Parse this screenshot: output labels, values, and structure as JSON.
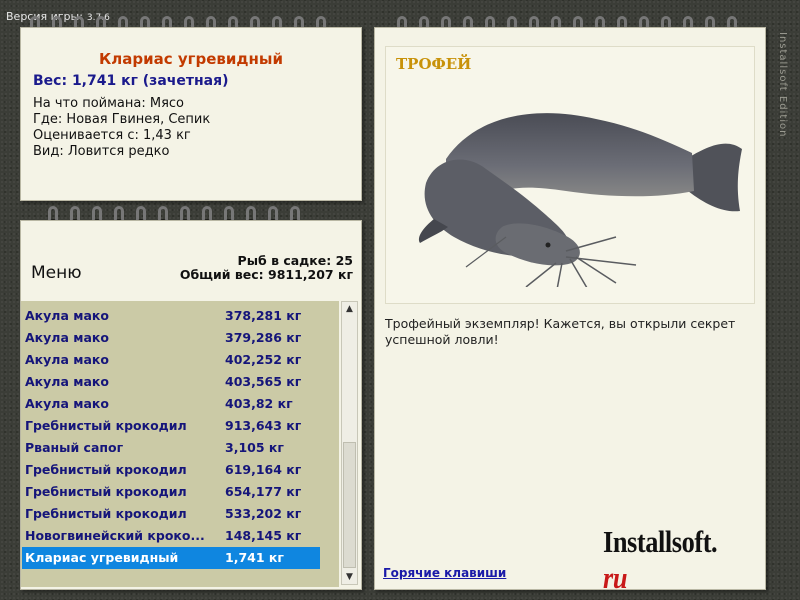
{
  "version": {
    "label": "Версия игры:",
    "number": "3.7.6"
  },
  "side_text": "Installsoft Edition",
  "info": {
    "title": "Клариас угревидный",
    "weight": "Вес: 1,741 кг (зачетная)",
    "bait": "На что поймана: Мясо",
    "location": "Где: Новая Гвинея, Сепик",
    "min_weight": "Оценивается с: 1,43 кг",
    "kind": "Вид: Ловится редко"
  },
  "catch": {
    "menu_label": "Меню",
    "fish_count": "Рыб в садке: 25",
    "total_weight": "Общий вес: 9811,207 кг",
    "rows": [
      {
        "name": "Акула мако",
        "weight": "378,281 кг"
      },
      {
        "name": "Акула мако",
        "weight": "379,286 кг"
      },
      {
        "name": "Акула мако",
        "weight": "402,252 кг"
      },
      {
        "name": "Акула мако",
        "weight": "403,565 кг"
      },
      {
        "name": "Акула мако",
        "weight": "403,82 кг"
      },
      {
        "name": "Гребнистый крокодил",
        "weight": "913,643 кг"
      },
      {
        "name": "Рваный сапог",
        "weight": "3,105 кг"
      },
      {
        "name": "Гребнистый крокодил",
        "weight": "619,164 кг"
      },
      {
        "name": "Гребнистый крокодил",
        "weight": "654,177 кг"
      },
      {
        "name": "Гребнистый крокодил",
        "weight": "533,202 кг"
      },
      {
        "name": "Новогвинейский кроко...",
        "weight": "148,145 кг"
      },
      {
        "name": "Клариас угревидный",
        "weight": "1,741 кг"
      }
    ],
    "selected_index": 11
  },
  "trophy": {
    "label": "ТРОФЕЙ",
    "message": "Трофейный экземпляр! Кажется, вы открыли секрет успешной ловли!",
    "hotkeys_link": "Горячие клавиши",
    "logo_main": "Installsoft.",
    "logo_ru": "ru"
  },
  "colors": {
    "title": "#c23a00",
    "weight": "#1a1a8c",
    "selected_row": "#0f86e0",
    "trophy_label": "#c8920a",
    "link": "#1a1aa8"
  }
}
